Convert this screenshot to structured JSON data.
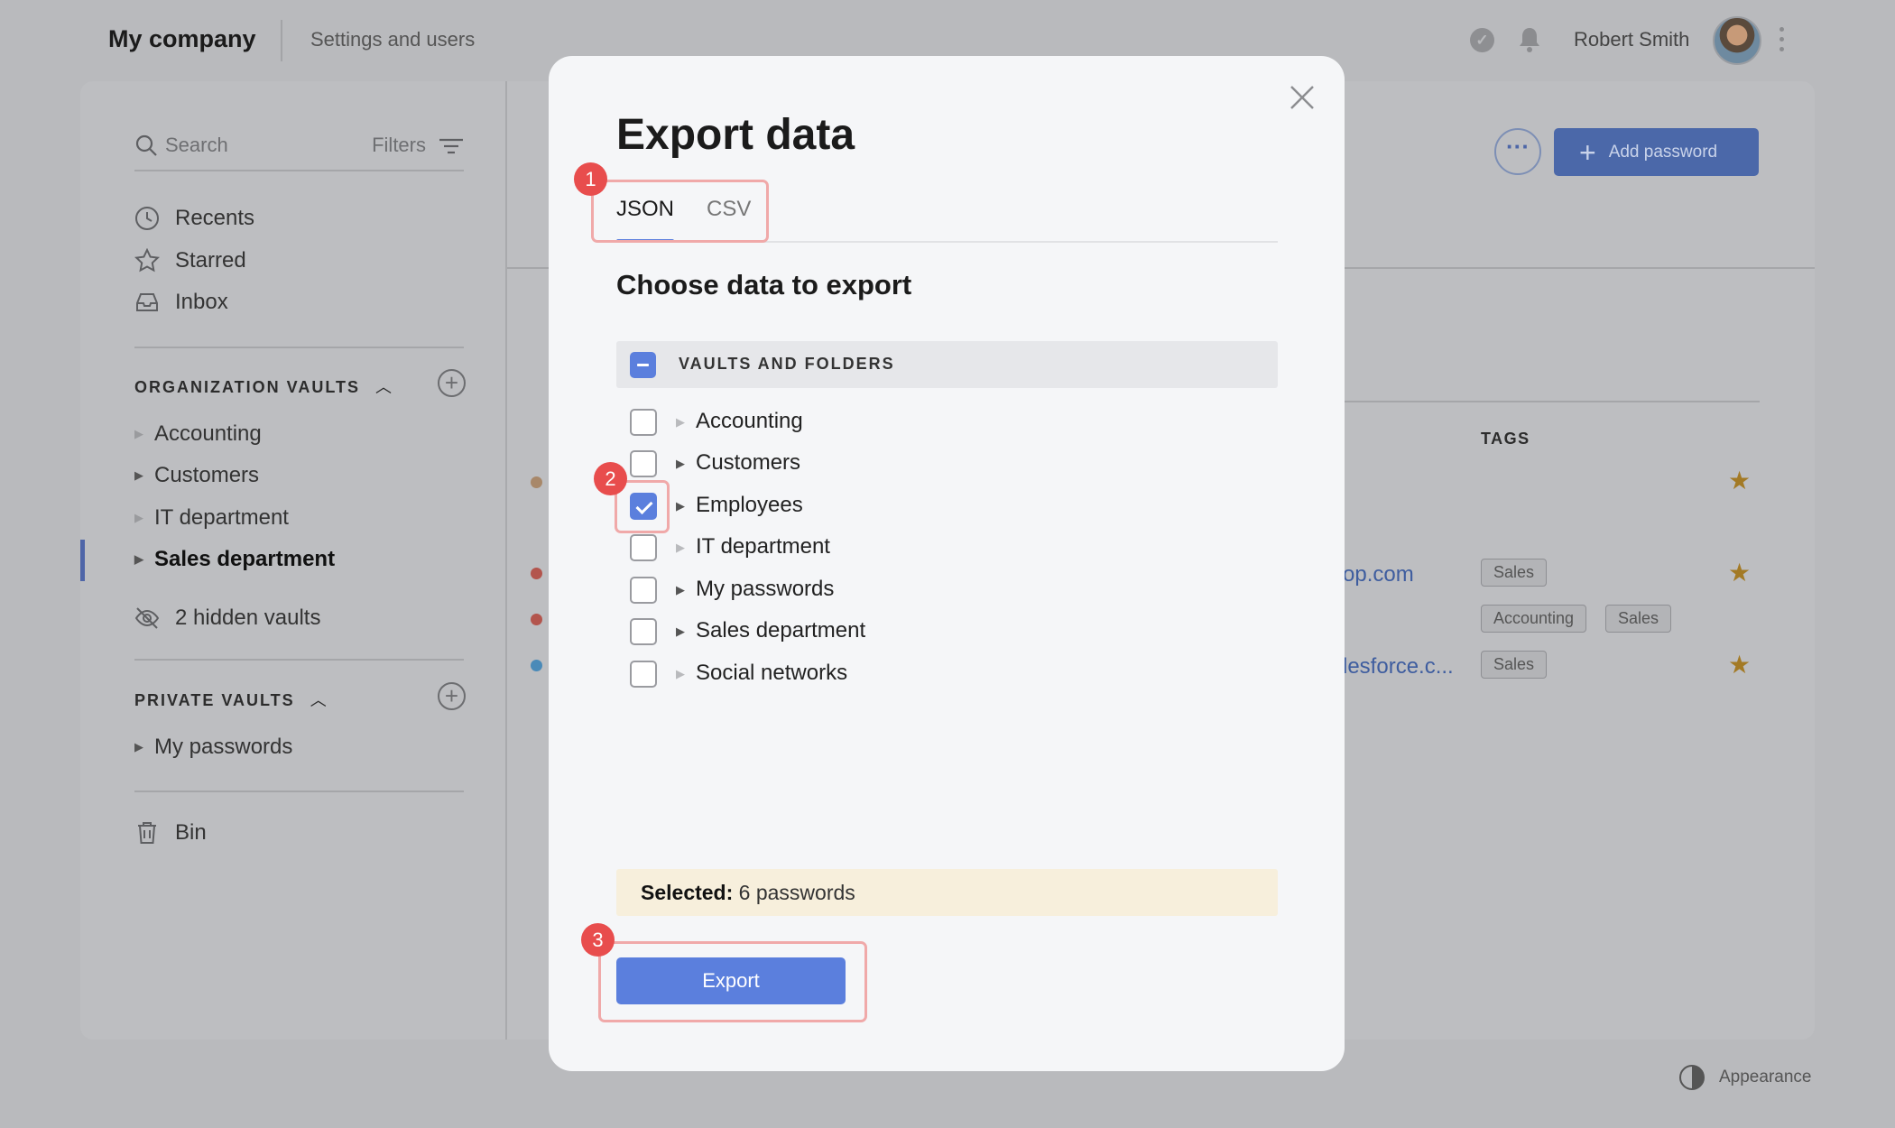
{
  "header": {
    "brand": "My company",
    "settings_link": "Settings and users",
    "user_name": "Robert Smith"
  },
  "sidebar": {
    "search_label": "Search",
    "filters_label": "Filters",
    "nav": [
      {
        "label": "Recents",
        "icon": "clock-icon"
      },
      {
        "label": "Starred",
        "icon": "star-icon"
      },
      {
        "label": "Inbox",
        "icon": "inbox-icon"
      }
    ],
    "org_section": "ORGANIZATION VAULTS",
    "org_vaults": [
      "Accounting",
      "Customers",
      "IT department",
      "Sales department"
    ],
    "active_vault": "Sales department",
    "hidden_vaults": "2 hidden vaults",
    "private_section": "PRIVATE VAULTS",
    "private_vaults": [
      "My passwords"
    ],
    "bin": "Bin"
  },
  "main": {
    "add_password_label": "Add password",
    "more_label": "···",
    "tags_header": "TAGS",
    "rows": [
      {
        "dot_color": "#a8886a",
        "link": "",
        "tags": [],
        "starred": true
      },
      {
        "dot_color": "#b3554d",
        "link": "op.com",
        "tags": [
          "Sales"
        ],
        "starred": true
      },
      {
        "dot_color": "#b3554d",
        "link": "",
        "tags": [
          "Accounting",
          "Sales"
        ],
        "starred": false
      },
      {
        "dot_color": "#4a8ab8",
        "link": "lesforce.c...",
        "tags": [
          "Sales"
        ],
        "starred": true
      }
    ]
  },
  "footer": {
    "appearance_label": "Appearance"
  },
  "modal": {
    "title": "Export data",
    "tabs": [
      {
        "label": "JSON",
        "active": true
      },
      {
        "label": "CSV",
        "active": false
      }
    ],
    "section_title": "Choose data to export",
    "group_label": "VAULTS AND FOLDERS",
    "items": [
      {
        "label": "Accounting",
        "checked": false,
        "expandable": false
      },
      {
        "label": "Customers",
        "checked": false,
        "expandable": true
      },
      {
        "label": "Employees",
        "checked": true,
        "expandable": true
      },
      {
        "label": "IT department",
        "checked": false,
        "expandable": false
      },
      {
        "label": "My passwords",
        "checked": false,
        "expandable": true
      },
      {
        "label": "Sales department",
        "checked": false,
        "expandable": true
      },
      {
        "label": "Social networks",
        "checked": false,
        "expandable": false
      }
    ],
    "selected_label": "Selected:",
    "selected_value": "6 passwords",
    "export_label": "Export",
    "step_badges": [
      "1",
      "2",
      "3"
    ],
    "accent_color": "#5b7fdd",
    "highlight_color": "#e84d4d"
  }
}
